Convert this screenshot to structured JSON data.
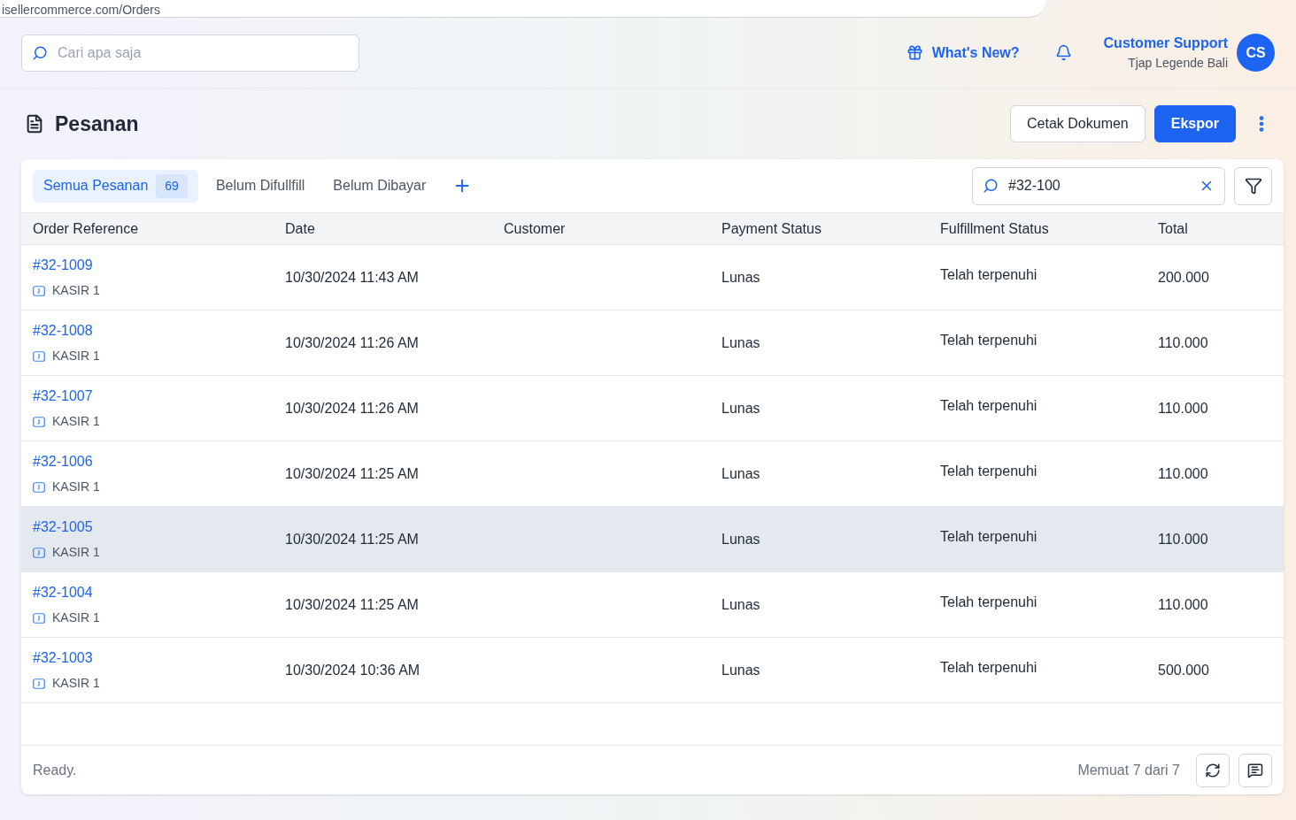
{
  "browser": {
    "url": "isellercommerce.com/Orders"
  },
  "topbar": {
    "search": {
      "placeholder": "Cari apa saja"
    },
    "whats_new": "What's New?",
    "user": {
      "name": "Customer Support",
      "store": "Tjap Legende Bali",
      "initials": "CS"
    }
  },
  "page": {
    "title": "Pesanan",
    "buttons": [
      {
        "label": "Cetak Dokumen",
        "kind": "secondary"
      },
      {
        "label": "Ekspor",
        "kind": "primary"
      }
    ]
  },
  "tabs": [
    {
      "label": "Semua Pesanan",
      "count": "69",
      "selected": true
    },
    {
      "label": "Belum Difullfill",
      "selected": false
    },
    {
      "label": "Belum Dibayar",
      "selected": false
    }
  ],
  "table_search": {
    "value": "#32-100"
  },
  "table": {
    "columns": [
      "Order Reference",
      "Date",
      "Customer",
      "Payment Status",
      "Fulfillment Status",
      "Total"
    ],
    "rows": [
      {
        "ref": "#32-1009",
        "channel": "KASIR 1",
        "date": "10/30/2024 11:43 AM",
        "payment": "Lunas",
        "fulfillment": "Telah terpenuhi",
        "total": "200.000",
        "highlighted": false
      },
      {
        "ref": "#32-1008",
        "channel": "KASIR 1",
        "date": "10/30/2024 11:26 AM",
        "payment": "Lunas",
        "fulfillment": "Telah terpenuhi",
        "total": "110.000",
        "highlighted": false
      },
      {
        "ref": "#32-1007",
        "channel": "KASIR 1",
        "date": "10/30/2024 11:26 AM",
        "payment": "Lunas",
        "fulfillment": "Telah terpenuhi",
        "total": "110.000",
        "highlighted": false
      },
      {
        "ref": "#32-1006",
        "channel": "KASIR 1",
        "date": "10/30/2024 11:25 AM",
        "payment": "Lunas",
        "fulfillment": "Telah terpenuhi",
        "total": "110.000",
        "highlighted": false
      },
      {
        "ref": "#32-1005",
        "channel": "KASIR 1",
        "date": "10/30/2024 11:25 AM",
        "payment": "Lunas",
        "fulfillment": "Telah terpenuhi",
        "total": "110.000",
        "highlighted": true
      },
      {
        "ref": "#32-1004",
        "channel": "KASIR 1",
        "date": "10/30/2024 11:25 AM",
        "payment": "Lunas",
        "fulfillment": "Telah terpenuhi",
        "total": "110.000",
        "highlighted": false
      },
      {
        "ref": "#32-1003",
        "channel": "KASIR 1",
        "date": "10/30/2024 10:36 AM",
        "payment": "Lunas",
        "fulfillment": "Telah terpenuhi",
        "total": "500.000",
        "highlighted": false
      }
    ]
  },
  "footer": {
    "status": "Ready.",
    "count": "Memuat 7 dari 7"
  }
}
